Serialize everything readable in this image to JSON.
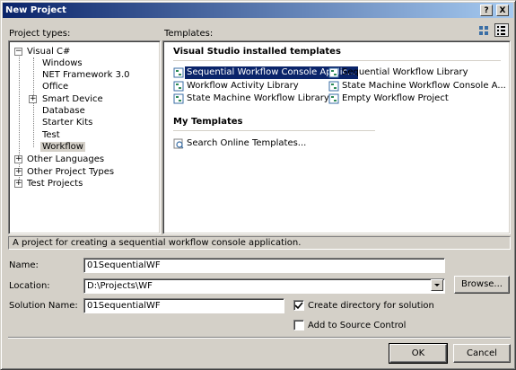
{
  "window": {
    "title": "New Project",
    "help_label": "?",
    "close_label": "X"
  },
  "project_types": {
    "label": "Project types:",
    "items": [
      {
        "label": "Visual C#",
        "expander": "-"
      },
      {
        "label": "Windows"
      },
      {
        "label": "NET Framework 3.0"
      },
      {
        "label": "Office"
      },
      {
        "label": "Smart Device",
        "expander": "+"
      },
      {
        "label": "Database"
      },
      {
        "label": "Starter Kits"
      },
      {
        "label": "Test"
      },
      {
        "label": "Workflow"
      },
      {
        "label": "Other Languages",
        "expander": "+"
      },
      {
        "label": "Other Project Types",
        "expander": "+"
      },
      {
        "label": "Test Projects",
        "expander": "+"
      }
    ]
  },
  "templates": {
    "label": "Templates:",
    "installed_heading": "Visual Studio installed templates",
    "installed": [
      {
        "label": "Sequential Workflow Console Applic..."
      },
      {
        "label": "Sequential Workflow Library"
      },
      {
        "label": "Workflow Activity Library"
      },
      {
        "label": "State Machine Workflow Console A..."
      },
      {
        "label": "State Machine Workflow Library"
      },
      {
        "label": "Empty Workflow Project"
      }
    ],
    "my_heading": "My Templates",
    "my": [
      {
        "label": "Search Online Templates..."
      }
    ]
  },
  "description": "A project for creating a sequential workflow console application.",
  "form": {
    "name_label": "Name:",
    "name_value": "01SequentialWF",
    "location_label": "Location:",
    "location_value": "D:\\Projects\\WF",
    "browse_label": "Browse...",
    "solution_label": "Solution Name:",
    "solution_value": "01SequentialWF",
    "create_dir_label": "Create directory for solution",
    "create_dir_checked": true,
    "source_control_label": "Add to Source Control",
    "source_control_checked": false
  },
  "buttons": {
    "ok": "OK",
    "cancel": "Cancel"
  },
  "colors": {
    "selection": "#0a246a",
    "dialog": "#d4d0c8"
  }
}
